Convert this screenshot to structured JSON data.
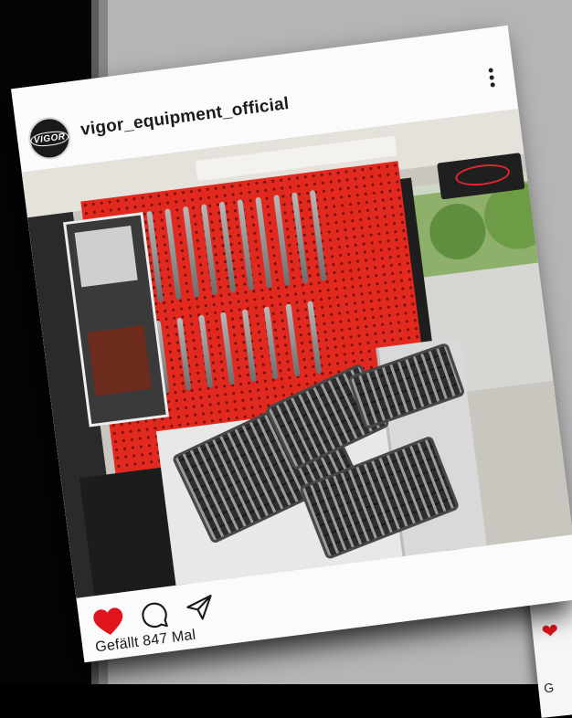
{
  "post": {
    "username": "vigor_equipment_official",
    "avatar_icon": "vigor-logo-icon",
    "avatar_text": "VIGOR",
    "likes_text": "Gefällt 847 Mal",
    "icons": {
      "more": "more-vertical-icon",
      "like": "heart-filled-icon",
      "comment": "comment-bubble-icon",
      "share": "paper-plane-icon"
    }
  },
  "background_post": {
    "likes_text_partial": "G"
  },
  "colors": {
    "like_red": "#e0141c",
    "card_bg": "#fbfbfb",
    "pegboard_red": "#e2291f"
  }
}
